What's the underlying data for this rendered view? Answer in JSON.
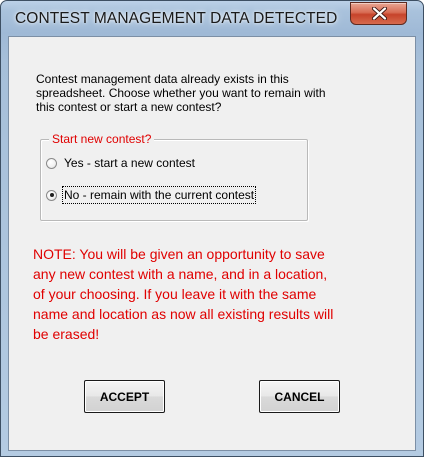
{
  "window": {
    "title": "CONTEST MANAGEMENT DATA DETECTED",
    "close_icon": "close-x-icon"
  },
  "dialog": {
    "intro_text": "Contest management data already exists in this\nspreadsheet.  Choose whether you want to remain with\nthis contest or start a new contest?",
    "group": {
      "legend": "Start new contest?",
      "options": [
        {
          "label": "Yes - start a new contest",
          "selected": false
        },
        {
          "label": "No - remain with the current contest",
          "selected": true
        }
      ]
    },
    "note_text": "NOTE: You will be given an opportunity to save\nany new contest with a name, and in a location,\nof your choosing.  If you leave it with the same\nname and location as now all existing results will\nbe erased!",
    "buttons": {
      "accept_label": "ACCEPT",
      "cancel_label": "CANCEL"
    }
  },
  "colors": {
    "note_red": "#e00000",
    "legend_red": "#e00000",
    "dialog_bg": "#f0f0f0",
    "close_button_red": "#c6432a"
  }
}
